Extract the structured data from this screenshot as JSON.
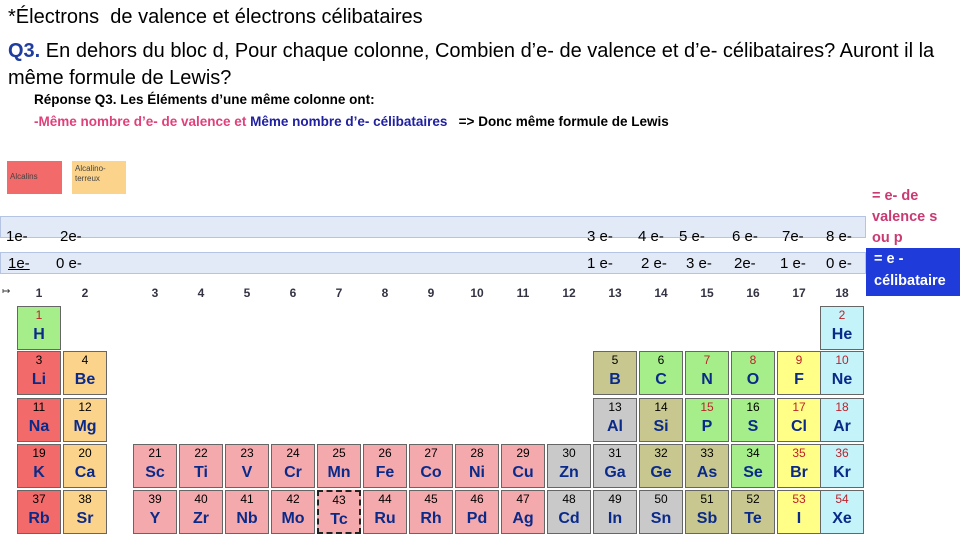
{
  "title": "*Électrons  de valence et électrons célibataires",
  "question": {
    "prefix": "Q3.",
    "text": " En dehors du bloc d, Pour chaque colonne, Combien d’e- de valence et d’e- célibataires? Auront il la même formule de Lewis?"
  },
  "answer": {
    "line1": "Réponse Q3. Les Éléments d’une même colonne ont:",
    "part_pink": "-Même nombre d’e- de valence et ",
    "part_blue": "Même nombre d’e- célibataires",
    "part_black": "=> Donc même formule de Lewis"
  },
  "legend": {
    "alcalins": "Alcalins",
    "alcalino_terreux": "Alcalino-terreux"
  },
  "side_notes": {
    "valence": "= e- de valence s ou p",
    "celibataire": "= e - célibataire"
  },
  "valence_row": [
    "1e-",
    "2e-",
    "3 e-",
    "4 e-",
    "5 e-",
    "6 e-",
    "7e-",
    "8 e-"
  ],
  "celib_row": [
    "1e-",
    "0 e-",
    "1 e-",
    "2 e-",
    "3 e-",
    "2e-",
    "1 e-",
    "0 e-"
  ],
  "arrow": "↦",
  "group_numbers": [
    "1",
    "2",
    "3",
    "4",
    "5",
    "6",
    "7",
    "8",
    "9",
    "10",
    "11",
    "12",
    "13",
    "14",
    "15",
    "16",
    "17",
    "18"
  ],
  "colors": {
    "alkali": "#f26a6a",
    "alkaline": "#fbd38a",
    "transition": "#f4a9ad",
    "poor": "#c9c9c9",
    "metalloid": "#c7c78f",
    "nonmetal": "#a6ee8a",
    "halogen": "#ffff88",
    "noble": "#c4f4f9",
    "hydrogen": "#a6ee8a"
  },
  "elements": [
    {
      "n": "1",
      "s": "H",
      "row": 0,
      "col": 0,
      "t": "hydrogen"
    },
    {
      "n": "2",
      "s": "He",
      "row": 0,
      "col": 17,
      "t": "noble"
    },
    {
      "n": "3",
      "s": "Li",
      "row": 1,
      "col": 0,
      "t": "alkali"
    },
    {
      "n": "4",
      "s": "Be",
      "row": 1,
      "col": 1,
      "t": "alkaline"
    },
    {
      "n": "5",
      "s": "B",
      "row": 1,
      "col": 12,
      "t": "metalloid"
    },
    {
      "n": "6",
      "s": "C",
      "row": 1,
      "col": 13,
      "t": "nonmetal"
    },
    {
      "n": "7",
      "s": "N",
      "row": 1,
      "col": 14,
      "t": "nonmetal"
    },
    {
      "n": "8",
      "s": "O",
      "row": 1,
      "col": 15,
      "t": "nonmetal"
    },
    {
      "n": "9",
      "s": "F",
      "row": 1,
      "col": 16,
      "t": "halogen"
    },
    {
      "n": "10",
      "s": "Ne",
      "row": 1,
      "col": 17,
      "t": "noble"
    },
    {
      "n": "11",
      "s": "Na",
      "row": 2,
      "col": 0,
      "t": "alkali"
    },
    {
      "n": "12",
      "s": "Mg",
      "row": 2,
      "col": 1,
      "t": "alkaline"
    },
    {
      "n": "13",
      "s": "Al",
      "row": 2,
      "col": 12,
      "t": "poor"
    },
    {
      "n": "14",
      "s": "Si",
      "row": 2,
      "col": 13,
      "t": "metalloid"
    },
    {
      "n": "15",
      "s": "P",
      "row": 2,
      "col": 14,
      "t": "nonmetal"
    },
    {
      "n": "16",
      "s": "S",
      "row": 2,
      "col": 15,
      "t": "nonmetal"
    },
    {
      "n": "17",
      "s": "Cl",
      "row": 2,
      "col": 16,
      "t": "halogen"
    },
    {
      "n": "18",
      "s": "Ar",
      "row": 2,
      "col": 17,
      "t": "noble"
    },
    {
      "n": "19",
      "s": "K",
      "row": 3,
      "col": 0,
      "t": "alkali"
    },
    {
      "n": "20",
      "s": "Ca",
      "row": 3,
      "col": 1,
      "t": "alkaline"
    },
    {
      "n": "21",
      "s": "Sc",
      "row": 3,
      "col": 2,
      "t": "transition"
    },
    {
      "n": "22",
      "s": "Ti",
      "row": 3,
      "col": 3,
      "t": "transition"
    },
    {
      "n": "23",
      "s": "V",
      "row": 3,
      "col": 4,
      "t": "transition"
    },
    {
      "n": "24",
      "s": "Cr",
      "row": 3,
      "col": 5,
      "t": "transition"
    },
    {
      "n": "25",
      "s": "Mn",
      "row": 3,
      "col": 6,
      "t": "transition"
    },
    {
      "n": "26",
      "s": "Fe",
      "row": 3,
      "col": 7,
      "t": "transition"
    },
    {
      "n": "27",
      "s": "Co",
      "row": 3,
      "col": 8,
      "t": "transition"
    },
    {
      "n": "28",
      "s": "Ni",
      "row": 3,
      "col": 9,
      "t": "transition"
    },
    {
      "n": "29",
      "s": "Cu",
      "row": 3,
      "col": 10,
      "t": "transition"
    },
    {
      "n": "30",
      "s": "Zn",
      "row": 3,
      "col": 11,
      "t": "poor"
    },
    {
      "n": "31",
      "s": "Ga",
      "row": 3,
      "col": 12,
      "t": "poor"
    },
    {
      "n": "32",
      "s": "Ge",
      "row": 3,
      "col": 13,
      "t": "metalloid"
    },
    {
      "n": "33",
      "s": "As",
      "row": 3,
      "col": 14,
      "t": "metalloid"
    },
    {
      "n": "34",
      "s": "Se",
      "row": 3,
      "col": 15,
      "t": "nonmetal"
    },
    {
      "n": "35",
      "s": "Br",
      "row": 3,
      "col": 16,
      "t": "halogen"
    },
    {
      "n": "36",
      "s": "Kr",
      "row": 3,
      "col": 17,
      "t": "noble"
    },
    {
      "n": "37",
      "s": "Rb",
      "row": 4,
      "col": 0,
      "t": "alkali"
    },
    {
      "n": "38",
      "s": "Sr",
      "row": 4,
      "col": 1,
      "t": "alkaline"
    },
    {
      "n": "39",
      "s": "Y",
      "row": 4,
      "col": 2,
      "t": "transition"
    },
    {
      "n": "40",
      "s": "Zr",
      "row": 4,
      "col": 3,
      "t": "transition"
    },
    {
      "n": "41",
      "s": "Nb",
      "row": 4,
      "col": 4,
      "t": "transition"
    },
    {
      "n": "42",
      "s": "Mo",
      "row": 4,
      "col": 5,
      "t": "transition"
    },
    {
      "n": "43",
      "s": "Tc",
      "row": 4,
      "col": 6,
      "t": "transition",
      "dashed": true
    },
    {
      "n": "44",
      "s": "Ru",
      "row": 4,
      "col": 7,
      "t": "transition"
    },
    {
      "n": "45",
      "s": "Rh",
      "row": 4,
      "col": 8,
      "t": "transition"
    },
    {
      "n": "46",
      "s": "Pd",
      "row": 4,
      "col": 9,
      "t": "transition"
    },
    {
      "n": "47",
      "s": "Ag",
      "row": 4,
      "col": 10,
      "t": "transition"
    },
    {
      "n": "48",
      "s": "Cd",
      "row": 4,
      "col": 11,
      "t": "poor"
    },
    {
      "n": "49",
      "s": "In",
      "row": 4,
      "col": 12,
      "t": "poor"
    },
    {
      "n": "50",
      "s": "Sn",
      "row": 4,
      "col": 13,
      "t": "poor"
    },
    {
      "n": "51",
      "s": "Sb",
      "row": 4,
      "col": 14,
      "t": "metalloid"
    },
    {
      "n": "52",
      "s": "Te",
      "row": 4,
      "col": 15,
      "t": "metalloid"
    },
    {
      "n": "53",
      "s": "I",
      "row": 4,
      "col": 16,
      "t": "halogen"
    },
    {
      "n": "54",
      "s": "Xe",
      "row": 4,
      "col": 17,
      "t": "noble"
    }
  ]
}
